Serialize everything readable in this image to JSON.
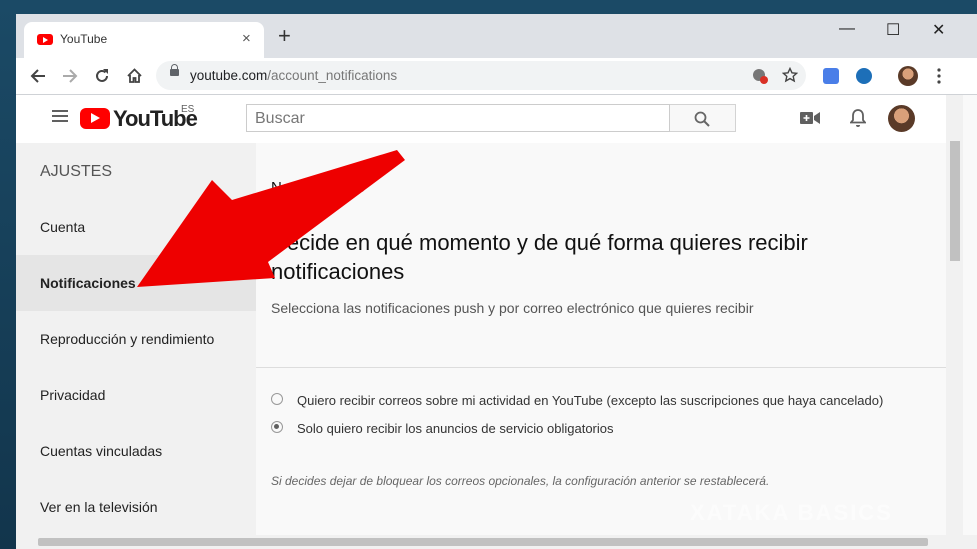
{
  "browser": {
    "tab_title": "YouTube",
    "tab_close": "×",
    "new_tab": "+",
    "url_domain": "youtube.com",
    "url_path": "/account_notifications",
    "minimize": "—",
    "maximize": "☐",
    "close": "✕"
  },
  "youtube": {
    "logo_text": "YouTube",
    "region": "ES",
    "search_placeholder": "Buscar"
  },
  "sidebar": {
    "title": "AJUSTES",
    "items": [
      {
        "label": "Cuenta",
        "active": false
      },
      {
        "label": "Notificaciones",
        "active": true
      },
      {
        "label": "Reproducción y rendimiento",
        "active": false
      },
      {
        "label": "Privacidad",
        "active": false
      },
      {
        "label": "Cuentas vinculadas",
        "active": false
      },
      {
        "label": "Ver en la televisión",
        "active": false
      }
    ]
  },
  "content": {
    "heading": "Notificaciones",
    "title": "Decide en qué momento y de qué forma quieres recibir notificaciones",
    "subtitle": "Selecciona las notificaciones push y por correo electrónico que quieres recibir",
    "email_options": [
      {
        "label": "Quiero recibir correos sobre mi actividad en YouTube (excepto las suscripciones que haya cancelado)",
        "selected": false
      },
      {
        "label": "Solo quiero recibir los anuncios de servicio obligatorios",
        "selected": true
      }
    ],
    "note": "Si decides dejar de bloquear los correos opcionales, la configuración anterior se restablecerá."
  },
  "watermark": "XATAKA BASICS",
  "colors": {
    "youtube_red": "#ff0000",
    "annotation_arrow": "#ee0000",
    "sidebar_bg": "#f1f1f1",
    "active_item_bg": "#e5e5e5"
  }
}
